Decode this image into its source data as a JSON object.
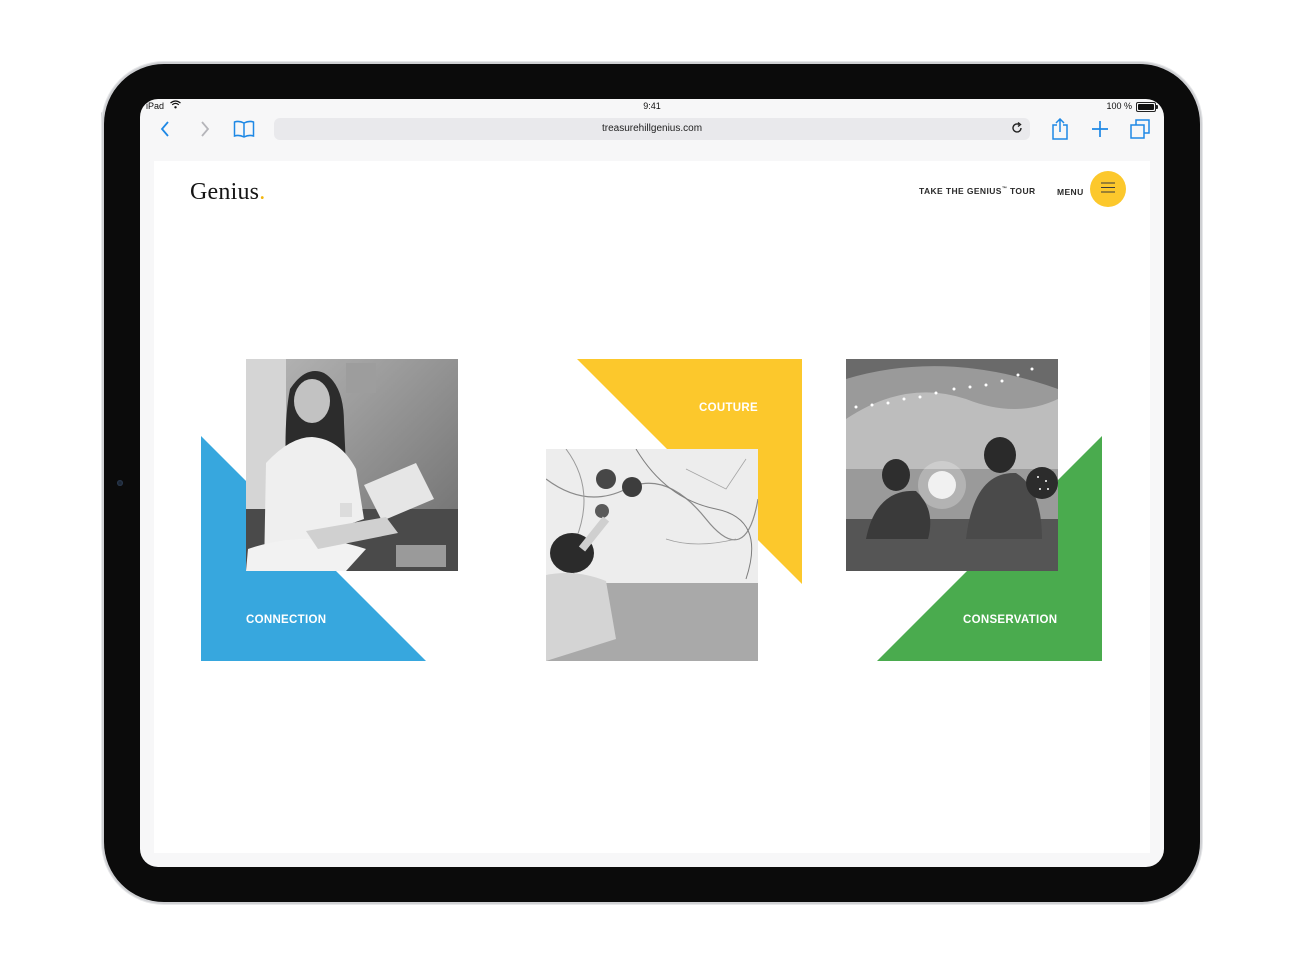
{
  "status_bar": {
    "device": "iPad",
    "time": "9:41",
    "battery": "100 %"
  },
  "browser": {
    "url": "treasurehillgenius.com",
    "icons": [
      "back-icon",
      "forward-icon",
      "bookmarks-icon",
      "reload-icon",
      "share-icon",
      "add-tab-icon",
      "tabs-icon"
    ]
  },
  "site": {
    "logo": "Genius",
    "logo_dot": ".",
    "tour_link_pre": "TAKE THE GENIUS",
    "tour_link_tm": "™",
    "tour_link_post": " TOUR",
    "menu_label": "MENU",
    "menu_icon": "hamburger-icon",
    "accent": "#fcc82c"
  },
  "tiles": [
    {
      "label": "CONNECTION",
      "color": "#37a7de",
      "photo": "woman-reading-tablet"
    },
    {
      "label": "COUTURE",
      "color": "#fcc82c",
      "photo": "marble-counter-overhead"
    },
    {
      "label": "CONSERVATION",
      "color": "#4aab4e",
      "photo": "kids-in-blanket-fort"
    }
  ]
}
